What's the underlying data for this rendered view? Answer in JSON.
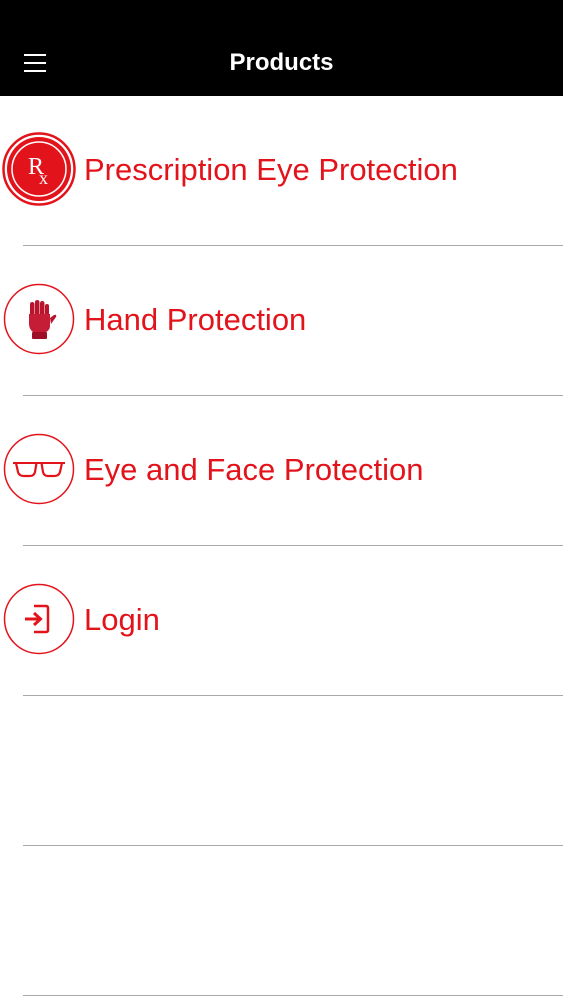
{
  "colors": {
    "accent": "#e3131b",
    "navbar_bg": "#000000",
    "navbar_text": "#ffffff",
    "separator": "#a9a9a9"
  },
  "navbar": {
    "title": "Products",
    "menu_icon": "hamburger-menu-icon"
  },
  "list": {
    "items": [
      {
        "label": "Prescription Eye Protection",
        "icon": "rx-icon"
      },
      {
        "label": "Hand Protection",
        "icon": "glove-icon"
      },
      {
        "label": "Eye and Face Protection",
        "icon": "glasses-icon"
      },
      {
        "label": "Login",
        "icon": "login-icon"
      }
    ]
  }
}
